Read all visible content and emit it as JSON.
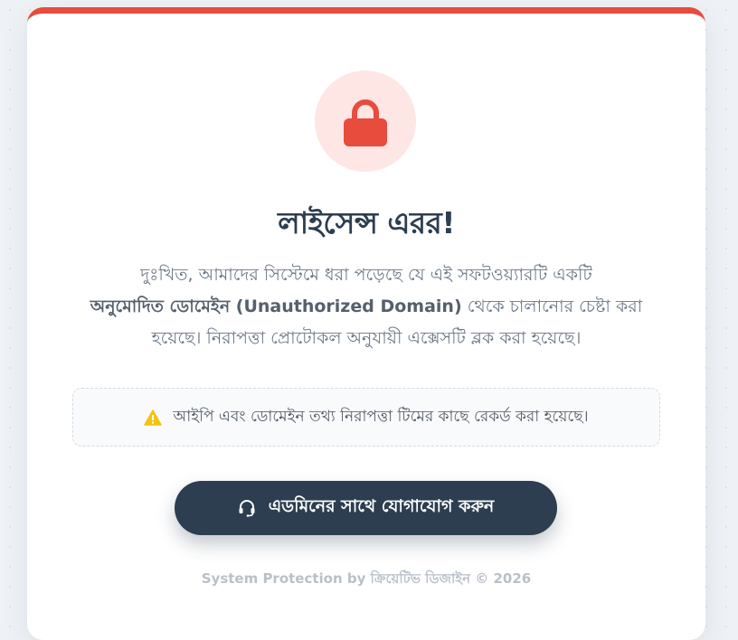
{
  "icons": {
    "main": "lock-icon",
    "notice": "warning-icon",
    "button": "headset-icon"
  },
  "colors": {
    "accent": "#e74c3c",
    "accent_soft": "#fde6e4",
    "primary_button": "#2c3e50",
    "warning": "#f1c40f"
  },
  "title": "লাইসেন্স এরর!",
  "message": {
    "part1": "দুঃখিত, আমাদের সিস্টেমে ধরা পড়েছে যে এই সফটওয়্যারটি একটি",
    "highlight": "অনুমোদিত ডোমেইন (Unauthorized Domain)",
    "part2": "থেকে চালানোর চেষ্টা করা হয়েছে। নিরাপত্তা প্রোটোকল অনুযায়ী এক্সেসটি ব্লক করা হয়েছে।"
  },
  "notice": {
    "text": "আইপি এবং ডোমেইন তথ্য নিরাপত্তা টিমের কাছে রেকর্ড করা হয়েছে।"
  },
  "contact_button": {
    "label": "এডমিনের সাথে যোগাযোগ করুন"
  },
  "footer": {
    "text": "System Protection by ক্রিয়েটিভ ডিজাইন © 2026"
  }
}
